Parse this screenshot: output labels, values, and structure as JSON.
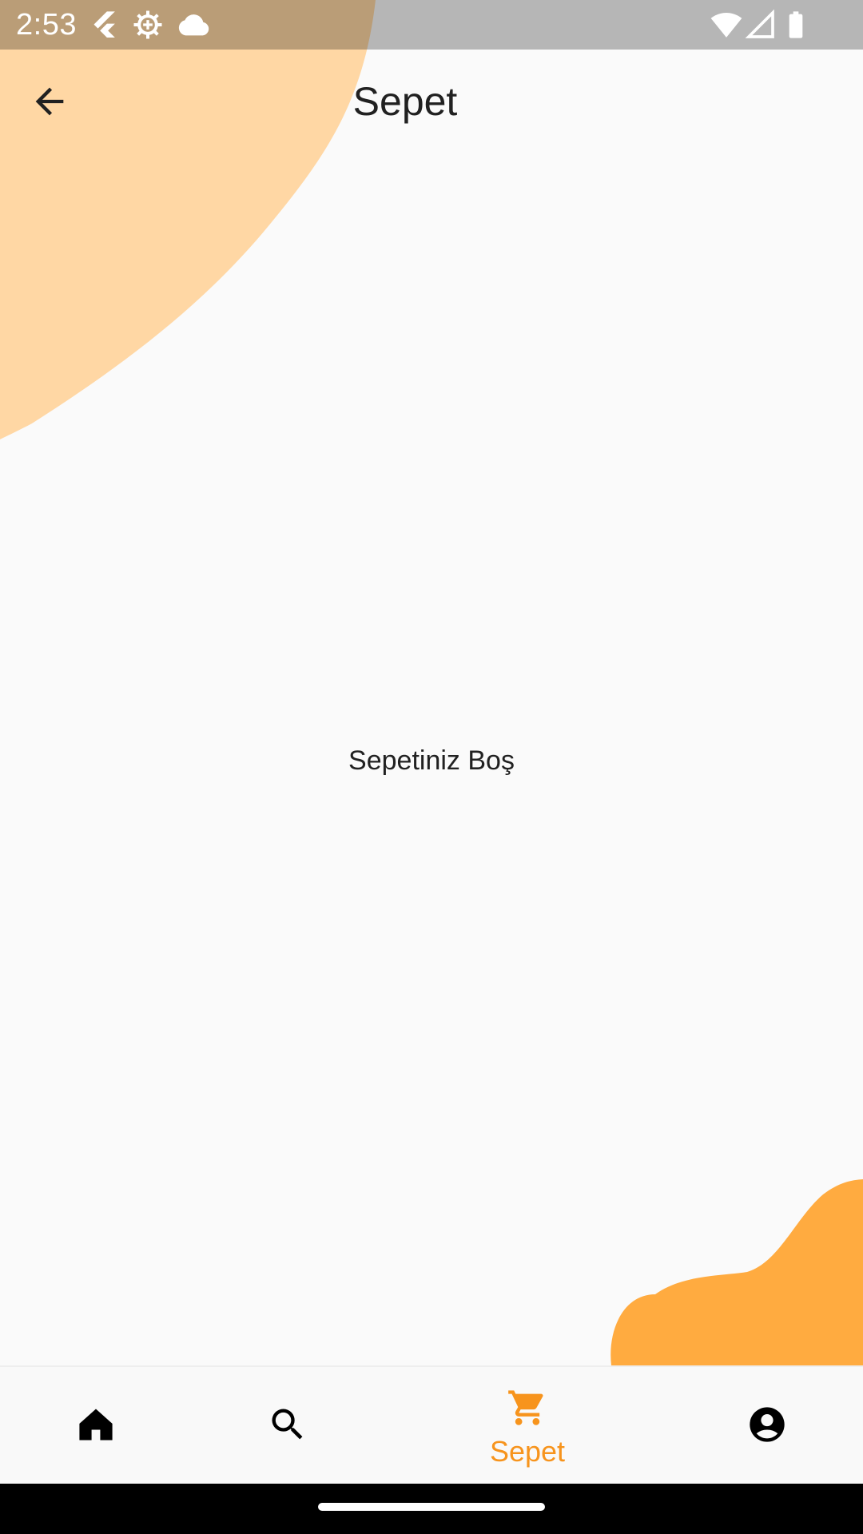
{
  "status_bar": {
    "time": "2:53",
    "icons": [
      "flutter-icon",
      "gear-icon",
      "cloud-icon",
      "wifi-icon",
      "signal-icon",
      "battery-icon"
    ]
  },
  "app_bar": {
    "title": "Sepet",
    "back_icon": "arrow-left-icon"
  },
  "main": {
    "empty_message": "Sepetiniz Boş"
  },
  "bottom_nav": {
    "items": [
      {
        "icon": "home-icon",
        "label": "",
        "active": false
      },
      {
        "icon": "search-icon",
        "label": "",
        "active": false
      },
      {
        "icon": "cart-icon",
        "label": "Sepet",
        "active": true
      },
      {
        "icon": "account-icon",
        "label": "",
        "active": false
      }
    ]
  },
  "colors": {
    "accent": "#f7941d",
    "blob_top_left": "#ffd7a4",
    "blob_bottom_right": "#ffab40",
    "background": "#fafafa",
    "text": "#212121"
  }
}
